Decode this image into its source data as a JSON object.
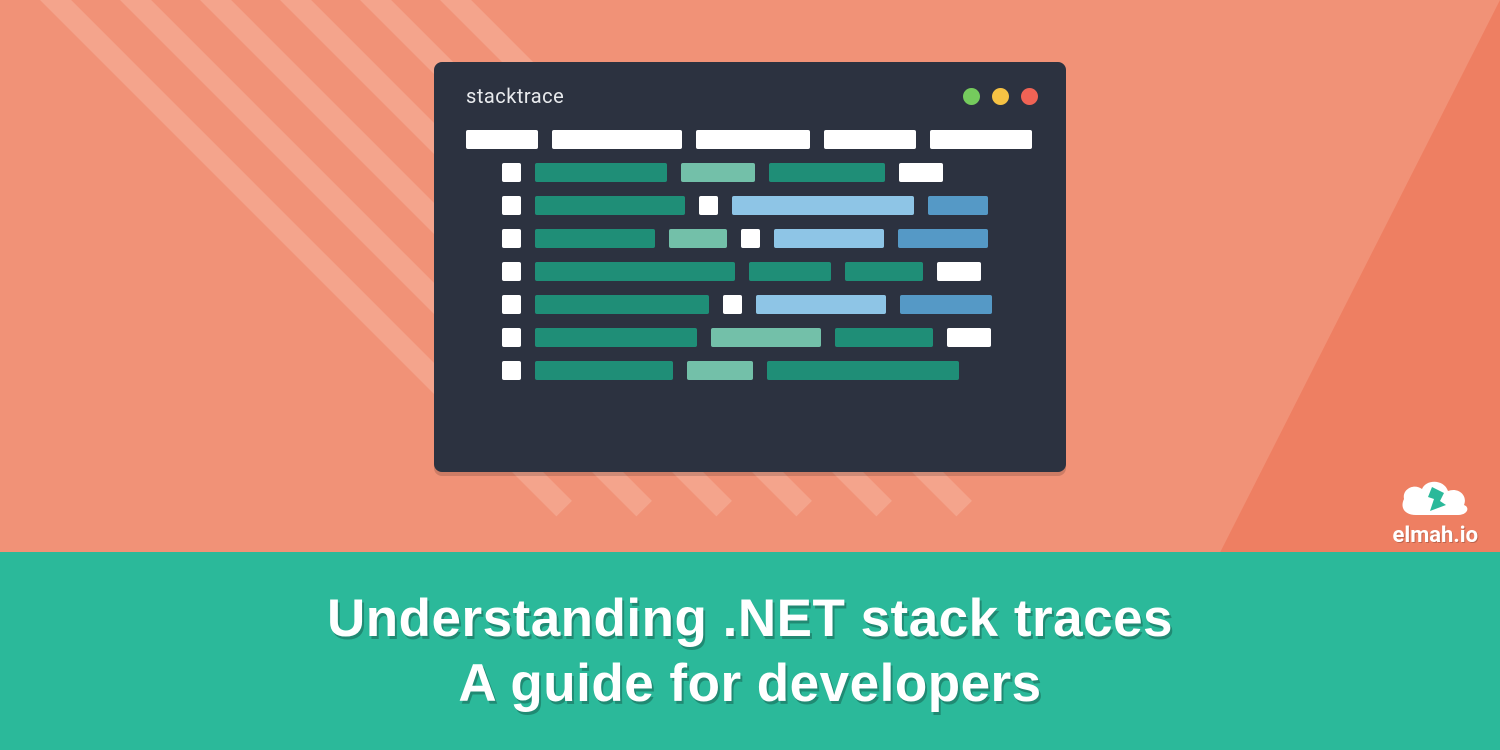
{
  "window": {
    "title": "stacktrace"
  },
  "banner": {
    "line1": "Understanding .NET stack traces",
    "line2": "A guide for developers"
  },
  "logo": {
    "text": "elmah.io"
  },
  "colors": {
    "bg_light": "#f19277",
    "bg_dark": "#ee7f62",
    "banner": "#2bb99a",
    "window": "#2c3240",
    "teal_dark": "#1f8e77",
    "teal_light": "#73c0a9",
    "blue_light": "#8ec5e6",
    "blue_dark": "#5599c6"
  }
}
